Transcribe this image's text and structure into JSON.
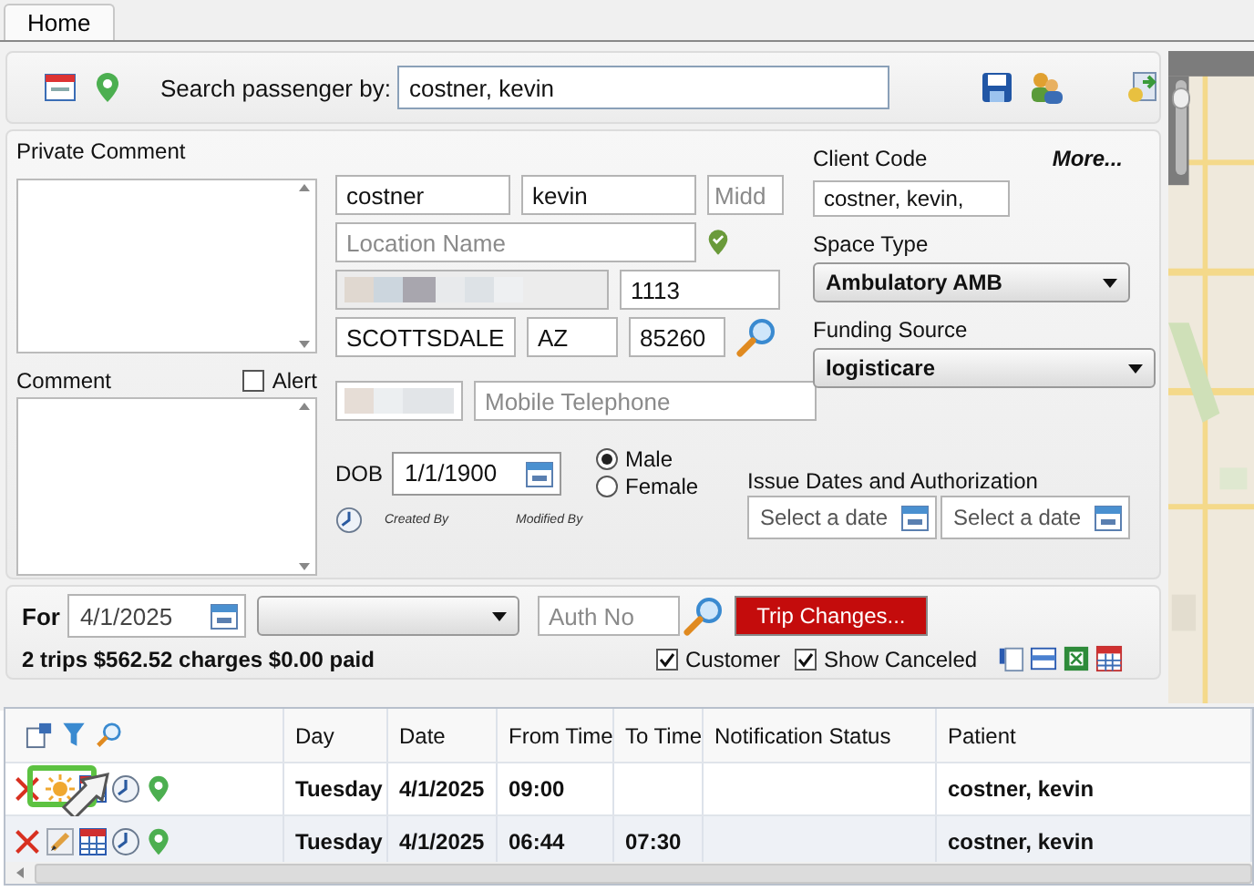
{
  "tabs": [
    {
      "label": "Home",
      "selected": true
    }
  ],
  "search": {
    "label": "Search passenger by:",
    "value": "costner, kevin"
  },
  "private_comment": {
    "label": "Private Comment"
  },
  "comment": {
    "label": "Comment"
  },
  "alert": {
    "label": "Alert",
    "checked": false
  },
  "name_fields": [
    {
      "value": "costner"
    },
    {
      "value": "kevin"
    },
    {
      "placeholder": "Midd"
    }
  ],
  "location": {
    "placeholder": "Location Name"
  },
  "address": {
    "suite": "1113",
    "city": "SCOTTSDALE",
    "state": "AZ",
    "zip": "85260"
  },
  "phone": {
    "placeholder": "Mobile Telephone"
  },
  "dob": {
    "label": "DOB",
    "value": "1/1/1900"
  },
  "gender": [
    {
      "label": "Male",
      "selected": true
    },
    {
      "label": "Female",
      "selected": false
    }
  ],
  "created_by": "Created By",
  "modified_by": "Modified By",
  "client_code": {
    "label": "Client Code",
    "value": "costner, kevin,"
  },
  "more": "More...",
  "space_type": {
    "label": "Space Type",
    "value": "Ambulatory AMB"
  },
  "funding_source": {
    "label": "Funding Source",
    "value": "logisticare"
  },
  "issue_dates": {
    "label": "Issue Dates and Authorization",
    "fields": [
      {
        "placeholder": "Select a date"
      },
      {
        "placeholder": "Select a date"
      }
    ]
  },
  "trip_filter": {
    "label": "For",
    "date": "4/1/2025",
    "auth_no": {
      "placeholder": "Auth No"
    },
    "trip_changes": "Trip Changes..."
  },
  "summary": "2 trips $562.52 charges $0.00 paid",
  "options": [
    {
      "label": "Customer",
      "checked": true
    },
    {
      "label": "Show Canceled",
      "checked": true
    }
  ],
  "map": {
    "zoom": {
      "level": 0.9
    }
  },
  "table": {
    "columns": [
      "Day",
      "Date",
      "From Time",
      "To Time",
      "Notification Status",
      "Patient"
    ],
    "rows": [
      {
        "highlighted": true,
        "cells": [
          "Tuesday",
          "4/1/2025",
          "09:00",
          "",
          "",
          "costner, kevin"
        ]
      },
      {
        "highlighted": false,
        "cells": [
          "Tuesday",
          "4/1/2025",
          "06:44",
          "07:30",
          "",
          "costner, kevin"
        ]
      }
    ]
  }
}
